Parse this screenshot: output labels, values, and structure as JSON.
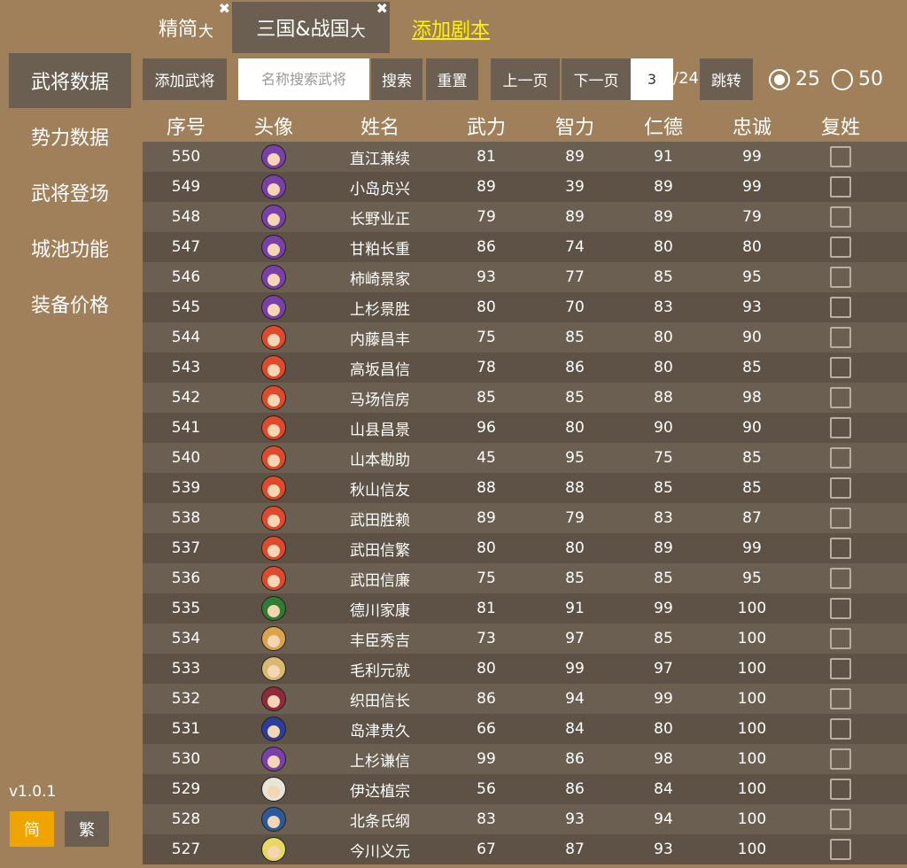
{
  "tabs": [
    {
      "label": "精简",
      "sub": "大",
      "close": "✖"
    },
    {
      "label": "三国&战国",
      "sub": "大",
      "close": "✖"
    }
  ],
  "add_script_link": "添加剧本",
  "sidebar": {
    "items": [
      "武将数据",
      "势力数据",
      "武将登场",
      "城池功能",
      "装备价格"
    ],
    "version": "v1.0.1",
    "lang_simplified": "简",
    "lang_traditional": "繁"
  },
  "toolbar": {
    "add_general": "添加武将",
    "search_placeholder": "名称搜索武将",
    "search": "搜索",
    "reset": "重置",
    "prev_page": "上一页",
    "next_page": "下一页",
    "current_page": "3",
    "total_pages": "/24",
    "jump": "跳转",
    "page_size_options": [
      "25",
      "50"
    ],
    "page_size_selected": "25"
  },
  "table": {
    "headers": [
      "序号",
      "头像",
      "姓名",
      "武力",
      "智力",
      "仁德",
      "忠诚",
      "复姓"
    ],
    "rows": [
      {
        "id": "550",
        "name": "直江兼续",
        "force": "81",
        "intel": "89",
        "virtue": "91",
        "loyalty": "99",
        "avatar_color": "#7a3fa8"
      },
      {
        "id": "549",
        "name": "小岛贞兴",
        "force": "89",
        "intel": "39",
        "virtue": "89",
        "loyalty": "99",
        "avatar_color": "#7a3fa8"
      },
      {
        "id": "548",
        "name": "长野业正",
        "force": "79",
        "intel": "89",
        "virtue": "89",
        "loyalty": "79",
        "avatar_color": "#7a3fa8"
      },
      {
        "id": "547",
        "name": "甘粕长重",
        "force": "86",
        "intel": "74",
        "virtue": "80",
        "loyalty": "80",
        "avatar_color": "#7a3fa8"
      },
      {
        "id": "546",
        "name": "柿崎景家",
        "force": "93",
        "intel": "77",
        "virtue": "85",
        "loyalty": "95",
        "avatar_color": "#7a3fa8"
      },
      {
        "id": "545",
        "name": "上杉景胜",
        "force": "80",
        "intel": "70",
        "virtue": "83",
        "loyalty": "93",
        "avatar_color": "#7a3fa8"
      },
      {
        "id": "544",
        "name": "内藤昌丰",
        "force": "75",
        "intel": "85",
        "virtue": "80",
        "loyalty": "90",
        "avatar_color": "#e04a2a"
      },
      {
        "id": "543",
        "name": "高坂昌信",
        "force": "78",
        "intel": "86",
        "virtue": "80",
        "loyalty": "85",
        "avatar_color": "#e04a2a"
      },
      {
        "id": "542",
        "name": "马场信房",
        "force": "85",
        "intel": "85",
        "virtue": "88",
        "loyalty": "98",
        "avatar_color": "#e04a2a"
      },
      {
        "id": "541",
        "name": "山县昌景",
        "force": "96",
        "intel": "80",
        "virtue": "90",
        "loyalty": "90",
        "avatar_color": "#e04a2a"
      },
      {
        "id": "540",
        "name": "山本勘助",
        "force": "45",
        "intel": "95",
        "virtue": "75",
        "loyalty": "85",
        "avatar_color": "#e04a2a"
      },
      {
        "id": "539",
        "name": "秋山信友",
        "force": "88",
        "intel": "88",
        "virtue": "85",
        "loyalty": "85",
        "avatar_color": "#e04a2a"
      },
      {
        "id": "538",
        "name": "武田胜赖",
        "force": "89",
        "intel": "79",
        "virtue": "83",
        "loyalty": "87",
        "avatar_color": "#e04a2a"
      },
      {
        "id": "537",
        "name": "武田信繁",
        "force": "80",
        "intel": "80",
        "virtue": "89",
        "loyalty": "99",
        "avatar_color": "#e04a2a"
      },
      {
        "id": "536",
        "name": "武田信廉",
        "force": "75",
        "intel": "85",
        "virtue": "85",
        "loyalty": "95",
        "avatar_color": "#e04a2a"
      },
      {
        "id": "535",
        "name": "德川家康",
        "force": "81",
        "intel": "91",
        "virtue": "99",
        "loyalty": "100",
        "avatar_color": "#2e7d32"
      },
      {
        "id": "534",
        "name": "丰臣秀吉",
        "force": "73",
        "intel": "97",
        "virtue": "85",
        "loyalty": "100",
        "avatar_color": "#d9a54a"
      },
      {
        "id": "533",
        "name": "毛利元就",
        "force": "80",
        "intel": "99",
        "virtue": "97",
        "loyalty": "100",
        "avatar_color": "#d9b870"
      },
      {
        "id": "532",
        "name": "织田信长",
        "force": "86",
        "intel": "94",
        "virtue": "99",
        "loyalty": "100",
        "avatar_color": "#8e2a3a"
      },
      {
        "id": "531",
        "name": "岛津贵久",
        "force": "66",
        "intel": "84",
        "virtue": "80",
        "loyalty": "100",
        "avatar_color": "#2a3f9a"
      },
      {
        "id": "530",
        "name": "上杉谦信",
        "force": "99",
        "intel": "86",
        "virtue": "98",
        "loyalty": "100",
        "avatar_color": "#7a3fa8"
      },
      {
        "id": "529",
        "name": "伊达植宗",
        "force": "56",
        "intel": "86",
        "virtue": "84",
        "loyalty": "100",
        "avatar_color": "#e8e4d8"
      },
      {
        "id": "528",
        "name": "北条氏纲",
        "force": "83",
        "intel": "93",
        "virtue": "94",
        "loyalty": "100",
        "avatar_color": "#2a5a9a"
      },
      {
        "id": "527",
        "name": "今川义元",
        "force": "67",
        "intel": "87",
        "virtue": "93",
        "loyalty": "100",
        "avatar_color": "#e8d860"
      }
    ]
  }
}
